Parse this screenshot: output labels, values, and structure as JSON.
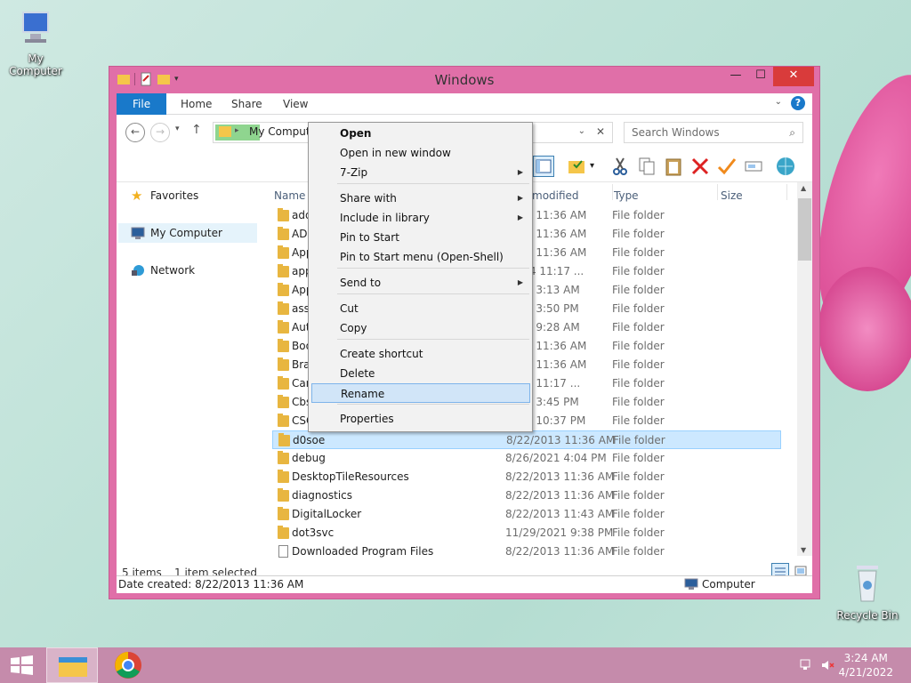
{
  "desktop": {
    "icons": [
      {
        "label": "My Computer"
      },
      {
        "label": "Recycle Bin"
      }
    ]
  },
  "window": {
    "title": "Windows",
    "controls": {
      "minimize": "—",
      "maximize": "☐",
      "close": "✕"
    },
    "ribbon_tabs": [
      "File",
      "Home",
      "Share",
      "View"
    ],
    "address": {
      "path": "My Computer"
    },
    "search": {
      "placeholder": "Search Windows"
    },
    "nav_pane": {
      "items": [
        {
          "label": "Favorites"
        },
        {
          "label": "My Computer"
        },
        {
          "label": "Network"
        }
      ]
    },
    "columns": {
      "name": "Name",
      "date": "modified",
      "type": "Type",
      "size": "Size"
    },
    "rows": [
      {
        "name": "add",
        "date": "2013 11:36 AM",
        "type": "File folder"
      },
      {
        "name": "ADF",
        "date": "2013 11:36 AM",
        "type": "File folder"
      },
      {
        "name": "App",
        "date": "2013 11:36 AM",
        "type": "File folder"
      },
      {
        "name": "app",
        "date": "/2014 11:17 ...",
        "type": "File folder"
      },
      {
        "name": "App",
        "date": "2021 3:13 AM",
        "type": "File folder"
      },
      {
        "name": "asse",
        "date": "2021 3:50 PM",
        "type": "File folder"
      },
      {
        "name": "Aut",
        "date": "2021 9:28 AM",
        "type": "File folder"
      },
      {
        "name": "Boo",
        "date": "2013 11:36 AM",
        "type": "File folder"
      },
      {
        "name": "Bra",
        "date": "2013 11:36 AM",
        "type": "File folder"
      },
      {
        "name": "Car",
        "date": "2014 11:17 ...",
        "type": "File folder"
      },
      {
        "name": "Cbs",
        "date": "2021 3:45 PM",
        "type": "File folder"
      },
      {
        "name": "CSC",
        "date": "2021 10:37 PM",
        "type": "File folder"
      },
      {
        "name": "d0soe",
        "date": "8/22/2013 11:36 AM",
        "type": "File folder",
        "selected": true
      },
      {
        "name": "debug",
        "date": "8/26/2021 4:04 PM",
        "type": "File folder"
      },
      {
        "name": "DesktopTileResources",
        "date": "8/22/2013 11:36 AM",
        "type": "File folder"
      },
      {
        "name": "diagnostics",
        "date": "8/22/2013 11:36 AM",
        "type": "File folder"
      },
      {
        "name": "DigitalLocker",
        "date": "8/22/2013 11:43 AM",
        "type": "File folder"
      },
      {
        "name": "dot3svc",
        "date": "11/29/2021 9:38 PM",
        "type": "File folder"
      },
      {
        "name": "Downloaded Program Files",
        "date": "8/22/2013 11:36 AM",
        "type": "File folder",
        "doc": true
      }
    ],
    "status": {
      "items": "5 items",
      "selected": "1 item selected"
    },
    "info": {
      "date_created": "Date created: 8/22/2013 11:36 AM",
      "location": "Computer"
    }
  },
  "context_menu": {
    "items": [
      {
        "label": "Open",
        "bold": true
      },
      {
        "label": "Open in new window"
      },
      {
        "label": "7-Zip",
        "submenu": true
      },
      {
        "label": "Share with",
        "submenu": true
      },
      {
        "label": "Include in library",
        "submenu": true
      },
      {
        "label": "Pin to Start"
      },
      {
        "label": "Pin to Start menu (Open-Shell)"
      },
      {
        "label": "Send to",
        "submenu": true
      },
      {
        "label": "Cut"
      },
      {
        "label": "Copy"
      },
      {
        "label": "Create shortcut"
      },
      {
        "label": "Delete"
      },
      {
        "label": "Rename",
        "highlighted": true
      },
      {
        "label": "Properties"
      }
    ]
  },
  "taskbar": {
    "clock": {
      "time": "3:24 AM",
      "date": "4/21/2022"
    }
  },
  "colors": {
    "accent": "#1979ca",
    "window_frame": "#e06fa8",
    "taskbar": "#c58bab"
  }
}
